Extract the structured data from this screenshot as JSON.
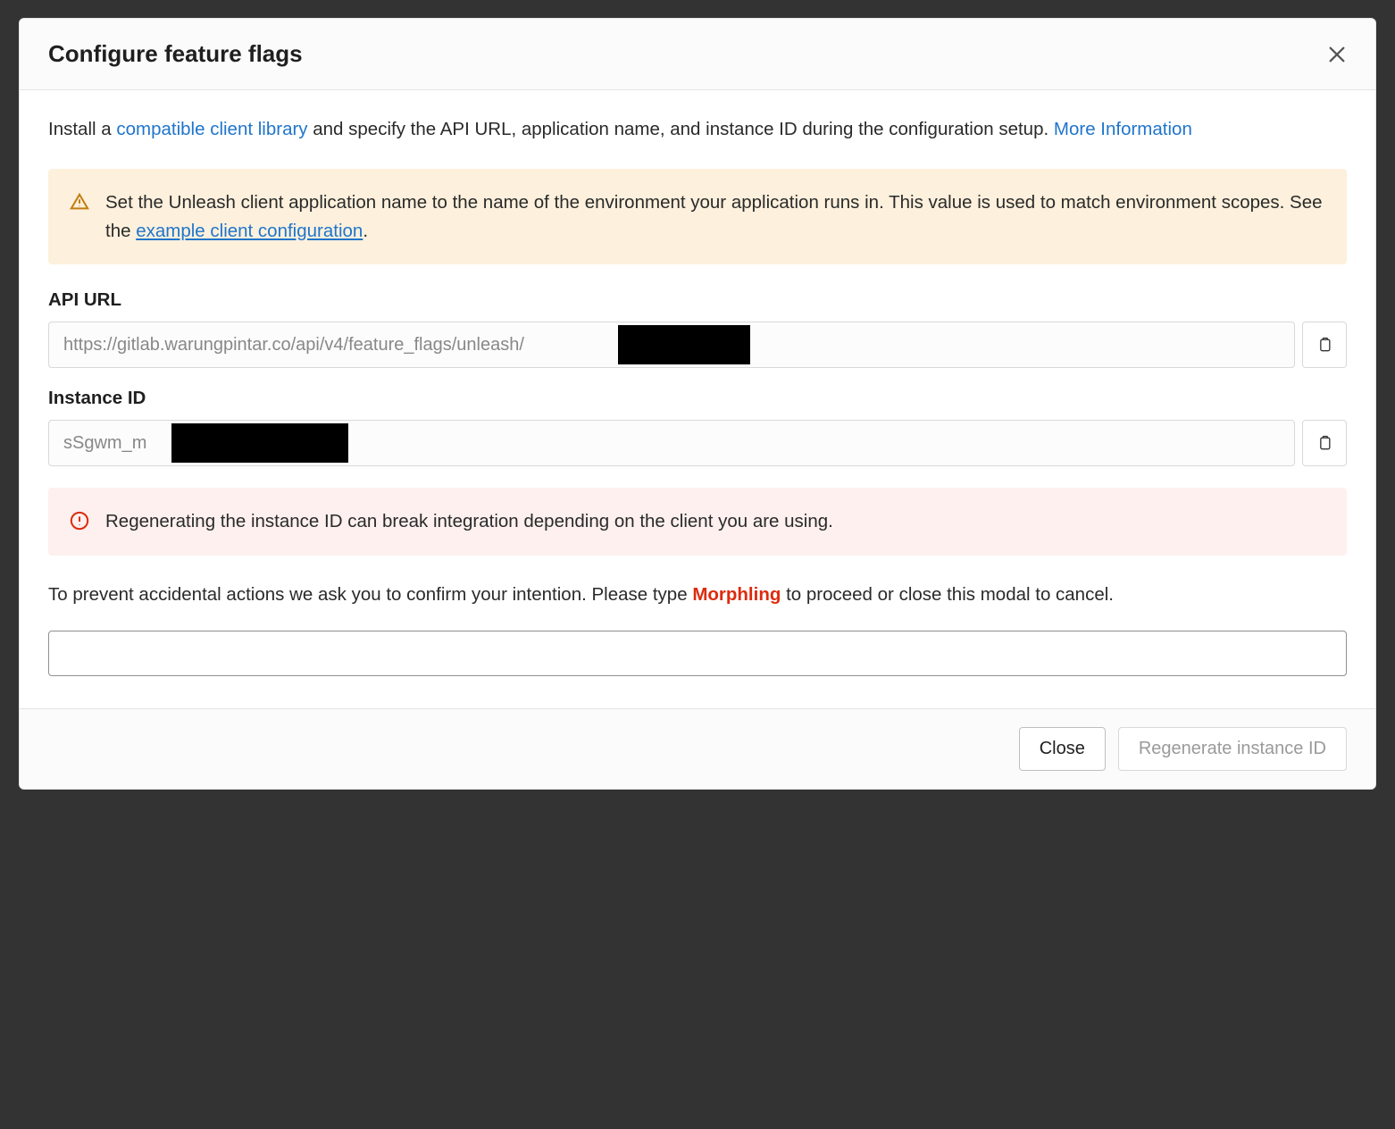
{
  "header": {
    "title": "Configure feature flags"
  },
  "intro": {
    "prefix": "Install a ",
    "link1": "compatible client library",
    "middle": " and specify the API URL, application name, and instance ID during the configuration setup. ",
    "link2": "More Information"
  },
  "alert_warn": {
    "text_before": "Set the Unleash client application name to the name of the environment your application runs in. This value is used to match environment scopes. See the ",
    "link": "example client configuration",
    "text_after": "."
  },
  "api_url": {
    "label": "API URL",
    "value": "https://gitlab.warungpintar.co/api/v4/feature_flags/unleash/"
  },
  "instance_id": {
    "label": "Instance ID",
    "value": "sSgwm_m"
  },
  "alert_danger": {
    "text": "Regenerating the instance ID can break integration depending on the client you are using."
  },
  "confirm": {
    "before": "To prevent accidental actions we ask you to confirm your intention. Please type ",
    "word": "Morphling",
    "after": " to proceed or close this modal to cancel."
  },
  "footer": {
    "close": "Close",
    "regenerate": "Regenerate instance ID"
  }
}
